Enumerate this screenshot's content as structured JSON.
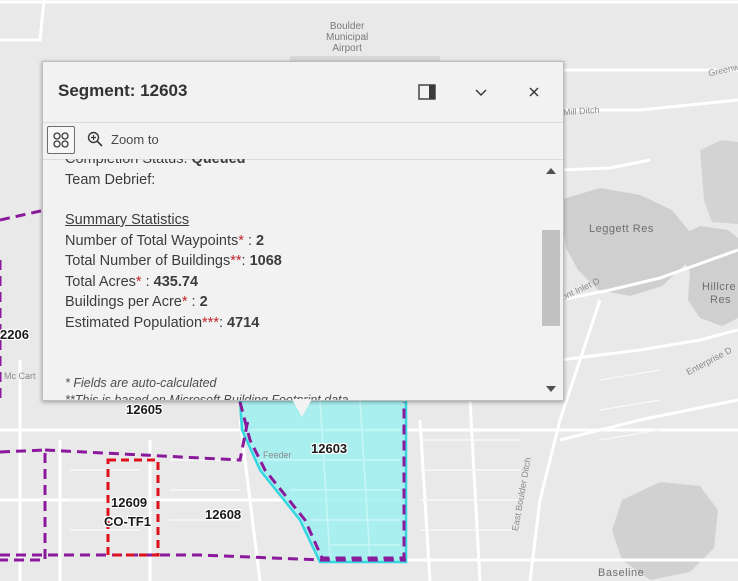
{
  "popup": {
    "title": "Segment: 12603",
    "dock_icon": "dock-side-icon",
    "collapse_icon": "chevron-down-icon",
    "close_icon": "close-icon",
    "actions": {
      "features_icon": "feature-grid-icon",
      "zoom_label": "Zoom to",
      "zoom_icon": "zoom-in-icon"
    },
    "content": {
      "completion_label": "Completion Status: ",
      "completion_value": "Queued",
      "team_debrief_label": "Team Debrief:",
      "section_heading": "Summary Statistics",
      "stats": [
        {
          "label": "Number of Total Waypoints",
          "marker": "*",
          "sep": " : ",
          "value": "2"
        },
        {
          "label": "Total Number of Buildings",
          "marker": "**",
          "sep": ": ",
          "value": "1068"
        },
        {
          "label": "Total Acres",
          "marker": "*",
          "sep": " : ",
          "value": "435.74"
        },
        {
          "label": "Buildings per Acre",
          "marker": "*",
          "sep": " : ",
          "value": "2"
        },
        {
          "label": "Estimated Population",
          "marker": "***",
          "sep": ": ",
          "value": "4714"
        }
      ],
      "footnote_1": "* Fields are auto-calculated",
      "footnote_2": "**This is based on Microsoft Building Footprint data"
    }
  },
  "map": {
    "poi_airport": [
      "Boulder",
      "Municipal",
      "Airport"
    ],
    "water_labels": {
      "leggett": "Leggett Res",
      "hillcrest_1": "Hillcre",
      "hillcrest_2": "Res",
      "baseline": "Baseline"
    },
    "road_labels": {
      "greenway": "Greenw",
      "mill_ditch": "Mill Ditch",
      "inlet": "ont Inlet D",
      "enterprise": "Enterprise D",
      "mccarty": "Mc Cart",
      "feeder": "Feeder",
      "east_boulder_ditch": "East Boulder Ditch"
    },
    "segments": {
      "s12206": "2206",
      "s12605": "12605",
      "s12603": "12603",
      "s12609": "12609",
      "s_co_tf1": "CO-TF1",
      "s12608": "12608"
    },
    "colors": {
      "selected_fill": "#9ff0f0",
      "selected_outline": "#35d6e0",
      "boundary_purple": "#8a1a9b",
      "boundary_red": "#e0101a"
    }
  }
}
